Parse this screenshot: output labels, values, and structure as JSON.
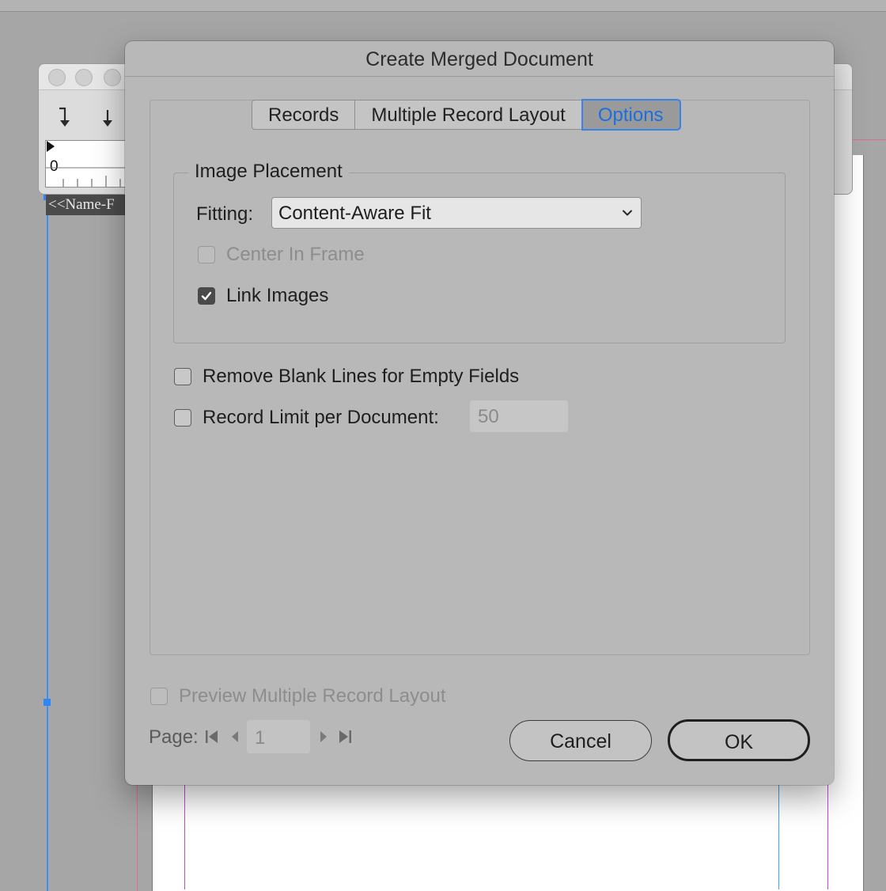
{
  "dialog": {
    "title": "Create Merged Document",
    "tabs": [
      {
        "label": "Records",
        "active": false
      },
      {
        "label": "Multiple Record Layout",
        "active": false
      },
      {
        "label": "Options",
        "active": true
      }
    ],
    "image_placement": {
      "legend": "Image Placement",
      "fitting_label": "Fitting:",
      "fitting_value": "Content-Aware Fit",
      "center_in_frame": {
        "label": "Center In Frame",
        "checked": false,
        "disabled": true
      },
      "link_images": {
        "label": "Link Images",
        "checked": true,
        "disabled": false
      }
    },
    "remove_blank_lines": {
      "label": "Remove Blank Lines for Empty Fields",
      "checked": false
    },
    "record_limit": {
      "label": "Record Limit per Document:",
      "checked": false,
      "value": "50"
    },
    "preview": {
      "label": "Preview Multiple Record Layout",
      "checked": false,
      "disabled": true
    },
    "page": {
      "label": "Page:",
      "value": "1"
    },
    "buttons": {
      "cancel": "Cancel",
      "ok": "OK"
    }
  },
  "background": {
    "ruler_zero": "0",
    "merge_field_text": "<<Name-F"
  },
  "colors": {
    "accent": "#1a6fe0",
    "selection": "#3d8ef5",
    "dialog_bg": "#b8b8b8"
  }
}
